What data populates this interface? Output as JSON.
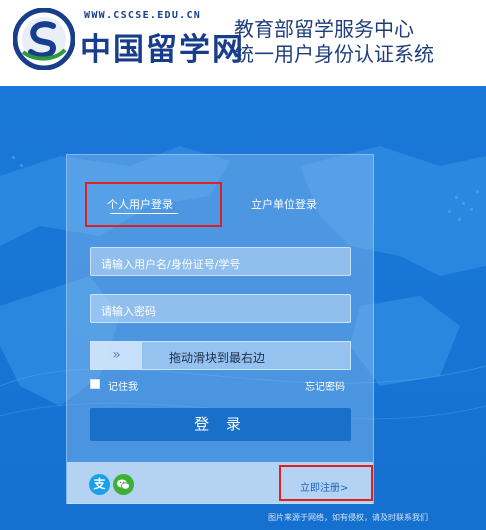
{
  "header": {
    "site_url": "WWW.CSCSE.EDU.CN",
    "site_name": "中国留学网",
    "system_title_line1": "教育部留学服务中心",
    "system_title_line2": "统一用户身份认证系统"
  },
  "login": {
    "tabs": [
      {
        "label": "个人用户登录",
        "active": true
      },
      {
        "label": "立户单位登录",
        "active": false
      }
    ],
    "username_placeholder": "请输入用户名/身份证号/学号",
    "password_placeholder": "请输入密码",
    "slider_handle_symbol": "»",
    "slider_text": "拖动滑块到最右边",
    "remember_label": "记住我",
    "forgot_label": "忘记密码",
    "submit_label": "登 录",
    "alipay_glyph": "支",
    "register_label": "立即注册>"
  },
  "watermark": "图片来源于网络，如有侵权，请及时联系我们",
  "colors": {
    "brand_blue": "#173d8c",
    "background_blue": "#1875d6",
    "button_blue": "#1a6fc8",
    "annotation_red": "#e02020",
    "alipay_blue": "#1aa0e8",
    "wechat_green": "#3cb034"
  },
  "icons": [
    "cscse-logo-icon",
    "alipay-icon",
    "wechat-icon",
    "double-chevron-right-icon"
  ]
}
